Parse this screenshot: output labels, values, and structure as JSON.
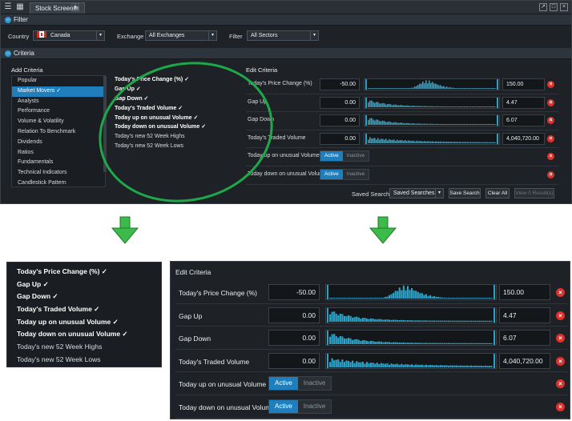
{
  "app": {
    "tab_title": "Stock Screener",
    "add_tab": "+"
  },
  "filter": {
    "header": "Filter",
    "country_label": "Country",
    "country_value": "Canada",
    "exchange_label": "Exchange",
    "exchange_value": "All Exchanges",
    "filter_label": "Filter",
    "filter_value": "All Sectors"
  },
  "criteria": {
    "header": "Criteria",
    "add_title": "Add Criteria",
    "edit_title": "Edit Criteria",
    "categories": [
      "Popular",
      "Market Movers ✓",
      "Analysts",
      "Performance",
      "Volume & Volatility",
      "Relation To Benchmark",
      "Dividends",
      "Ratios",
      "Fundamentals",
      "Technical Indicators",
      "Candlestick Pattern"
    ],
    "selected_category_index": 1,
    "items": [
      {
        "label": "Today's Price Change (%) ✓",
        "checked": true
      },
      {
        "label": "Gap Up ✓",
        "checked": true
      },
      {
        "label": "Gap Down ✓",
        "checked": true
      },
      {
        "label": "Today's Traded Volume ✓",
        "checked": true
      },
      {
        "label": "Today up on unusual Volume ✓",
        "checked": true
      },
      {
        "label": "Today down on unusual Volume ✓",
        "checked": true
      },
      {
        "label": "Today's new 52 Week Highs",
        "checked": false
      },
      {
        "label": "Today's new 52 Week Lows",
        "checked": false
      }
    ]
  },
  "edit_rows": [
    {
      "label": "Today's Price Change (%)",
      "min": "-50.00",
      "max": "150.00",
      "hist": "bell"
    },
    {
      "label": "Gap Up",
      "min": "0.00",
      "max": "4.47",
      "hist": "decay"
    },
    {
      "label": "Gap Down",
      "min": "0.00",
      "max": "6.07",
      "hist": "decay"
    },
    {
      "label": "Today's Traded Volume",
      "min": "0.00",
      "max": "4,040,720.00",
      "hist": "decay2"
    }
  ],
  "toggle_rows": [
    {
      "label": "Today up on unusual Volume",
      "on": "Active",
      "off": "Inactive"
    },
    {
      "label": "Today down on unusual Volume",
      "on": "Active",
      "off": "Inactive"
    }
  ],
  "bottom": {
    "saved_label": "Saved Searches",
    "saved_value": "Saved Searches",
    "save_btn": "Save Search",
    "clear_btn": "Clear All",
    "view_btn": "View 0 Result(s)"
  },
  "zoom_left_items": [
    {
      "label": "Today's Price Change (%) ✓",
      "checked": true
    },
    {
      "label": "Gap Up ✓",
      "checked": true
    },
    {
      "label": "Gap Down ✓",
      "checked": true
    },
    {
      "label": "Today's Traded Volume ✓",
      "checked": true
    },
    {
      "label": "Today up on unusual Volume ✓",
      "checked": true
    },
    {
      "label": "Today down on unusual Volume ✓",
      "checked": true
    },
    {
      "label": "Today's new 52 Week Highs",
      "checked": false
    },
    {
      "label": "Today's new 52 Week Lows",
      "checked": false
    }
  ],
  "colors": {
    "accent": "#1f7fbd",
    "highlight": "#1fa84a",
    "delete": "#e0302a",
    "hist": "#2ba3c9"
  }
}
